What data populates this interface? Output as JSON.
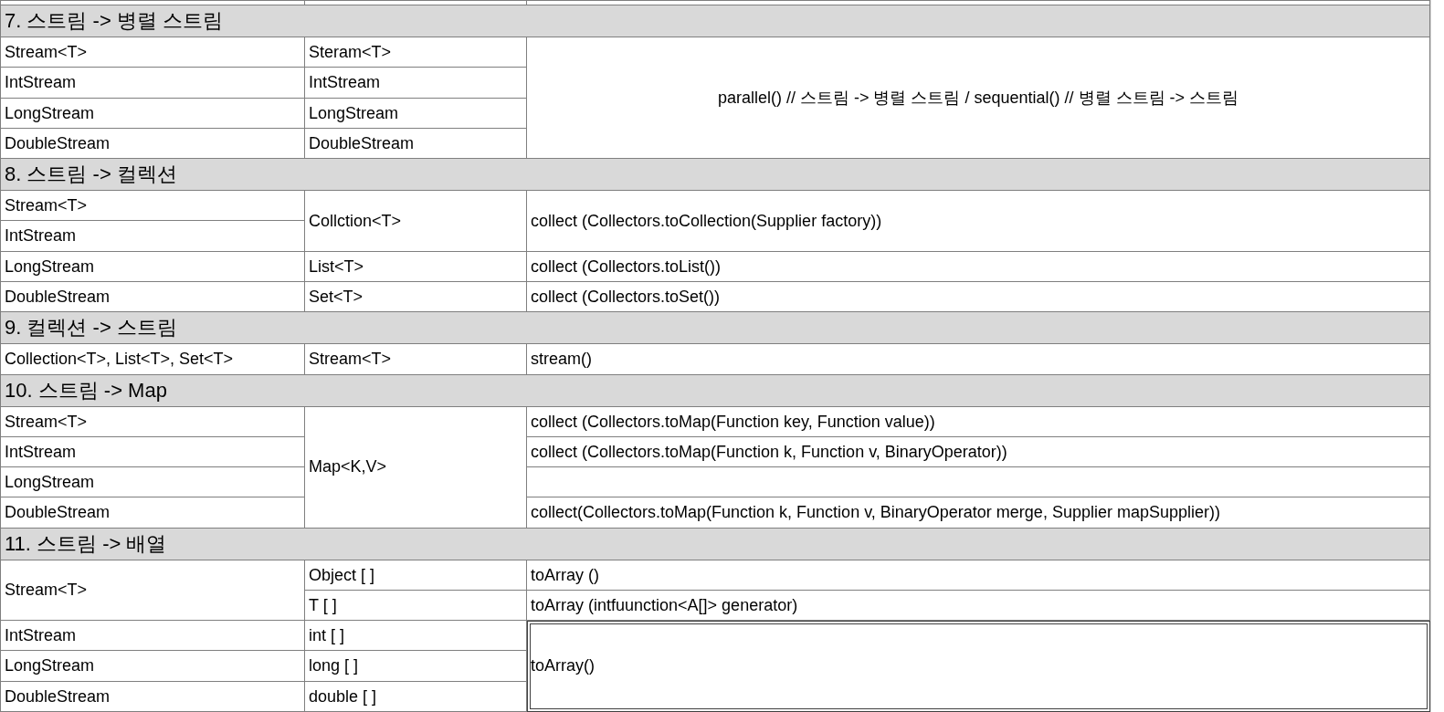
{
  "sections": [
    {
      "title": "7. 스트림 -> 병렬 스트림",
      "rows": [
        {
          "cells": [
            {
              "text": "Stream<T>",
              "selected": false
            },
            {
              "text": "Steram<T>",
              "selected": false
            },
            {
              "text": "parallel() // 스트림 -> 병렬 스트림 / sequential() // 병렬 스트림 -> 스트림",
              "selected": false,
              "rowspan": 4
            }
          ]
        },
        {
          "cells": [
            {
              "text": "IntStream",
              "selected": false
            },
            {
              "text": "IntStream",
              "selected": false
            }
          ]
        },
        {
          "cells": [
            {
              "text": "LongStream",
              "selected": false
            },
            {
              "text": "LongStream",
              "selected": false
            }
          ]
        },
        {
          "cells": [
            {
              "text": "DoubleStream",
              "selected": false
            },
            {
              "text": "DoubleStream",
              "selected": false
            }
          ]
        }
      ]
    },
    {
      "title": "8. 스트림 -> 컬렉션",
      "rows": [
        {
          "cells": [
            {
              "text": "Stream<T>",
              "selected": false
            },
            {
              "text": "Collction<T>",
              "selected": false,
              "rowspan": 2
            },
            {
              "text": "collect (Collectors.toCollection(Supplier factory))",
              "selected": false,
              "rowspan": 2
            }
          ]
        },
        {
          "cells": [
            {
              "text": "IntStream",
              "selected": false
            }
          ]
        },
        {
          "cells": [
            {
              "text": "LongStream",
              "selected": false
            },
            {
              "text": "List<T>",
              "selected": false
            },
            {
              "text": "collect (Collectors.toList())",
              "selected": false
            }
          ]
        },
        {
          "cells": [
            {
              "text": "DoubleStream",
              "selected": false
            },
            {
              "text": "Set<T>",
              "selected": false
            },
            {
              "text": "collect (Collectors.toSet())",
              "selected": false
            }
          ]
        }
      ]
    },
    {
      "title": "9. 컬렉션 -> 스트림",
      "rows": [
        {
          "cells": [
            {
              "text": "Collection<T>, List<T>, Set<T>",
              "selected": false
            },
            {
              "text": "Stream<T>",
              "selected": false
            },
            {
              "text": "stream()",
              "selected": false
            }
          ]
        }
      ]
    },
    {
      "title": "10. 스트림 -> Map",
      "rows": [
        {
          "cells": [
            {
              "text": "Stream<T>",
              "selected": false
            },
            {
              "text": "Map<K,V>",
              "selected": false,
              "rowspan": 4
            },
            {
              "text": "collect (Collectors.toMap(Function key, Function value))",
              "selected": false
            }
          ]
        },
        {
          "cells": [
            {
              "text": "IntStream",
              "selected": false
            },
            {
              "text": "collect (Collectors.toMap(Function k, Function v, BinaryOperator))",
              "selected": false
            }
          ]
        },
        {
          "cells": [
            {
              "text": "LongStream",
              "selected": false
            }
          ]
        },
        {
          "cells": [
            {
              "text": "DoubleStream",
              "selected": false
            },
            {
              "text": "collect(Collectors.toMap(Function k, Function v, BinaryOperator merge, Supplier mapSupplier))",
              "selected": false
            }
          ]
        }
      ]
    },
    {
      "title": "11. 스트림 -> 배열",
      "rows": [
        {
          "cells": [
            {
              "text": "Stream<T>",
              "selected": false,
              "rowspan": 2
            },
            {
              "text": "Object [ ]",
              "selected": false
            },
            {
              "text": "toArray ()",
              "selected": false
            }
          ]
        },
        {
          "cells": [
            {
              "text": "T [ ]",
              "selected": false
            },
            {
              "text": "toArray (intfuunction<A[]> generator)",
              "selected": false
            }
          ]
        },
        {
          "cells": [
            {
              "text": "IntStream",
              "selected": false
            },
            {
              "text": "int [ ]",
              "selected": false
            },
            {
              "text": "toArray()",
              "selected": true,
              "rowspan": 3
            }
          ]
        },
        {
          "cells": [
            {
              "text": "LongStream",
              "selected": false
            },
            {
              "text": "long [ ]",
              "selected": false
            }
          ]
        },
        {
          "cells": [
            {
              "text": "DoubleStream",
              "selected": false
            },
            {
              "text": "double [ ]",
              "selected": false
            }
          ]
        }
      ]
    }
  ]
}
